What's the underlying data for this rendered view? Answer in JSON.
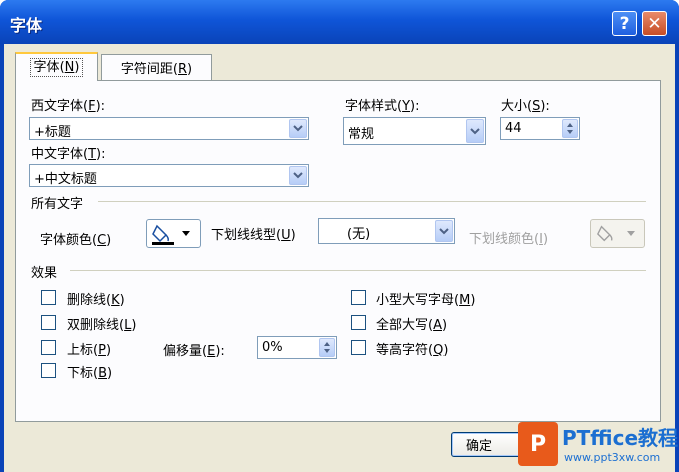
{
  "window": {
    "title": "字体",
    "help_label": "?",
    "close_label": "✕"
  },
  "tabs": [
    {
      "label": "字体(N)",
      "prefix": "字体",
      "key": "N",
      "active": true
    },
    {
      "label": "字符间距(R)",
      "prefix": "字符间距",
      "key": "R",
      "active": false
    }
  ],
  "latin_font": {
    "label_prefix": "西文字体",
    "key": "F",
    "label_suffix": "):",
    "value": "+标题"
  },
  "font_style": {
    "label_prefix": "字体样式",
    "key": "Y",
    "label_suffix": "):",
    "value": "常规"
  },
  "font_size": {
    "label_prefix": "大小",
    "key": "S",
    "label_suffix": "):",
    "value": "44"
  },
  "asian_font": {
    "label_prefix": "中文字体",
    "key": "T",
    "label_suffix": "):",
    "value": "+中文标题"
  },
  "all_text": {
    "group_label": "所有文字",
    "font_color": {
      "label_prefix": "字体颜色",
      "key": "C",
      "label_suffix": ")",
      "swatch_color": "#000000"
    },
    "underline_style": {
      "label_prefix": "下划线线型",
      "key": "U",
      "label_suffix": ")",
      "value": "(无)"
    },
    "underline_color": {
      "label_prefix": "下划线颜色",
      "key": "I",
      "label_suffix": ")",
      "disabled": true
    }
  },
  "effects": {
    "group_label": "效果",
    "items": [
      {
        "label_prefix": "删除线",
        "key": "K",
        "checked": false
      },
      {
        "label_prefix": "双删除线",
        "key": "L",
        "checked": false
      },
      {
        "label_prefix": "上标",
        "key": "P",
        "checked": false
      },
      {
        "label_prefix": "下标",
        "key": "B",
        "checked": false
      },
      {
        "label_prefix": "小型大写字母",
        "key": "M",
        "checked": false
      },
      {
        "label_prefix": "全部大写",
        "key": "A",
        "checked": false
      },
      {
        "label_prefix": "等高字符",
        "key": "Q",
        "checked": false
      }
    ],
    "offset": {
      "label_prefix": "偏移量",
      "key": "E",
      "label_suffix": "):",
      "value": "0%"
    }
  },
  "buttons": {
    "ok": "确定"
  },
  "watermark": {
    "logo": "P",
    "title": "PTffice教程网",
    "url": "www.ppt3xw.com"
  },
  "colors": {
    "title_bar": "#0a43b8",
    "client_bg": "#ece9d8",
    "field_border": "#7f9db9",
    "tab_highlight": "#ffc83c"
  }
}
